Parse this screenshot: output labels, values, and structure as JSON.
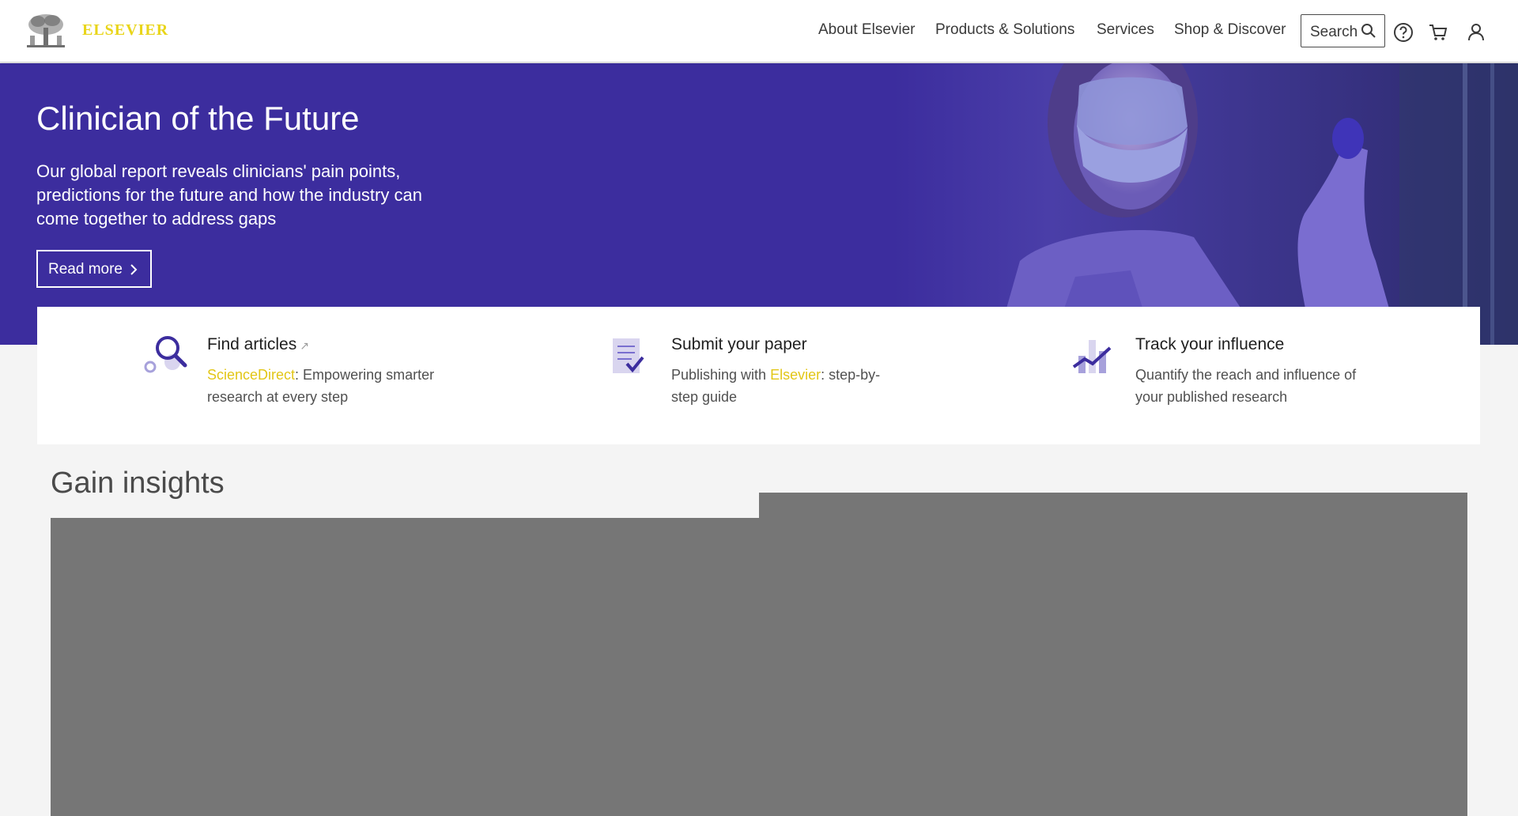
{
  "brand": {
    "name": "ELSEVIER",
    "colors": {
      "accent": "#3c2d9e",
      "highlight": "#e2c617"
    }
  },
  "nav": {
    "items": [
      "About Elsevier",
      "Products & Solutions",
      "Services",
      "Shop & Discover"
    ],
    "search_label": "Search",
    "icons": [
      "help-icon",
      "cart-icon",
      "user-icon"
    ]
  },
  "hero": {
    "title": "Clinician of the Future",
    "text": "Our global report reveals clinicians' pain points, predictions for the future and how the industry can come together to address gaps",
    "cta": "Read more"
  },
  "features": [
    {
      "title": "Find articles",
      "ext": "↗",
      "link": "ScienceDirect",
      "desc": ": Empowering smarter research at every step"
    },
    {
      "title": "Submit your paper",
      "prefix": "Publishing with ",
      "link": "Elsevier",
      "desc": ": step-by-step guide"
    },
    {
      "title": "Track your influence",
      "desc": "Quantify the reach and influence of your published research"
    }
  ],
  "insights": {
    "title": "Gain insights"
  }
}
